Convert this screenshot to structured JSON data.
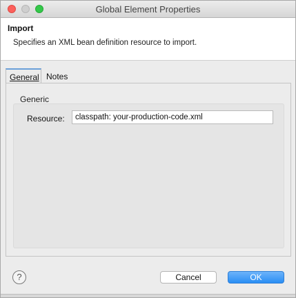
{
  "window": {
    "title": "Global Element Properties"
  },
  "banner": {
    "title": "Import",
    "description": "Specifies an XML bean definition resource to import."
  },
  "tabs": [
    {
      "label": "General",
      "selected": true
    },
    {
      "label": "Notes",
      "selected": false
    }
  ],
  "general": {
    "group_label": "Generic",
    "resource_label": "Resource:",
    "resource_value": "classpath: your-production-code.xml"
  },
  "footer": {
    "help_icon": "?",
    "cancel_label": "Cancel",
    "ok_label": "OK"
  },
  "colors": {
    "accent": "#2a8ef4",
    "close": "#fc605c",
    "maximize": "#34c84a"
  }
}
